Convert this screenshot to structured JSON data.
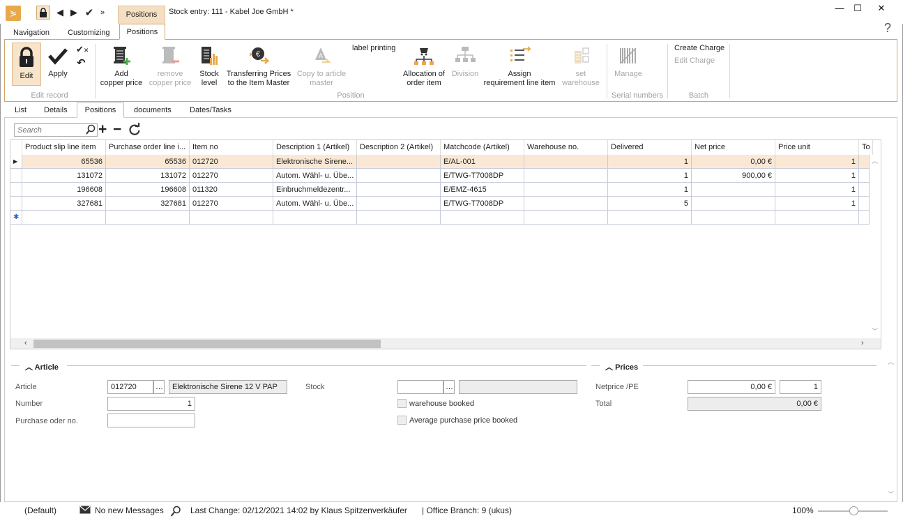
{
  "window": {
    "title": "Stock entry: 111 - Kabel Joe GmbH *",
    "context_tab": "Positions",
    "minimize": "—",
    "maximize": "☐",
    "close": "✕"
  },
  "ribbon_tabs": [
    "Navigation",
    "Customizing",
    "Positions"
  ],
  "help": "?",
  "ribbon": {
    "edit": "Edit",
    "apply": "Apply",
    "group_edit_record": "Edit record",
    "add_copper_price": [
      "Add",
      "copper price"
    ],
    "remove_copper_price": [
      "remove",
      "copper price"
    ],
    "stock_level": [
      "Stock",
      "level"
    ],
    "transferring_prices": [
      "Transferring Prices",
      "to the Item Master"
    ],
    "copy_to_article_master": [
      "Copy to article",
      "master"
    ],
    "label_printing": "label printing",
    "allocation_of_order_item": [
      "Allocation of",
      "order item"
    ],
    "division": "Division",
    "assign_requirement": [
      "Assign",
      "requirement line item"
    ],
    "set_warehouse": [
      "set",
      "warehouse"
    ],
    "group_position": "Position",
    "manage": "Manage",
    "group_serial_numbers": "Serial numbers",
    "create_charge": "Create Charge",
    "edit_charge": "Edit Charge",
    "group_batch": "Batch"
  },
  "sub_tabs": [
    "List",
    "Details",
    "Positions",
    "documents",
    "Dates/Tasks"
  ],
  "grid": {
    "search_placeholder": "Search",
    "columns": [
      "Product slip line item",
      "Purchase order line i...",
      "Item no",
      "Description 1 (Artikel)",
      "Description 2 (Artikel)",
      "Matchcode (Artikel)",
      "Warehouse no.",
      "Delivered",
      "Net price",
      "Price unit",
      "To"
    ],
    "rows": [
      {
        "slip": "65536",
        "po": "65536",
        "item": "012720",
        "desc1": "Elektronische Sirene...",
        "desc2": "",
        "match": "E/AL-001",
        "wh": "",
        "delivered": "1",
        "net": "0,00 €",
        "unit": "1"
      },
      {
        "slip": "131072",
        "po": "131072",
        "item": "012270",
        "desc1": "Autom. Wähl- u. Übe...",
        "desc2": "",
        "match": "E/TWG-T7008DP",
        "wh": "",
        "delivered": "1",
        "net": "900,00 €",
        "unit": "1"
      },
      {
        "slip": "196608",
        "po": "196608",
        "item": "011320",
        "desc1": "Einbruchmeldezentr...",
        "desc2": "",
        "match": "E/EMZ-4615",
        "wh": "",
        "delivered": "1",
        "net": "",
        "unit": "1"
      },
      {
        "slip": "327681",
        "po": "327681",
        "item": "012270",
        "desc1": "Autom. Wähl- u. Übe...",
        "desc2": "",
        "match": "E/TWG-T7008DP",
        "wh": "",
        "delivered": "5",
        "net": "",
        "unit": "1"
      }
    ]
  },
  "article": {
    "section": "Article",
    "article_label": "Article",
    "article_value": "012720",
    "article_desc": "Elektronische Sirene 12 V PAP",
    "number_label": "Number",
    "number_value": "1",
    "po_label": "Purchase oder no.",
    "po_value": "",
    "stock_label": "Stock",
    "stock_value": "",
    "warehouse_booked": "warehouse booked",
    "avg_price_booked": "Average purchase price booked"
  },
  "prices": {
    "section": "Prices",
    "netprice_label": "Netprice /PE",
    "netprice_value": "0,00 €",
    "pe_value": "1",
    "total_label": "Total",
    "total_value": "0,00 €"
  },
  "status": {
    "layout": "(Default)",
    "messages": "No new Messages",
    "last_change": "Last Change: 02/12/2021 14:02 by Klaus Spitzenverkäufer",
    "office_branch": "| Office Branch:  9 (ukus)",
    "zoom": "100%"
  },
  "colors": {
    "accent": "#d2a56a",
    "selected_row": "#fbe8d4",
    "context_tab": "#f4dfc3"
  }
}
